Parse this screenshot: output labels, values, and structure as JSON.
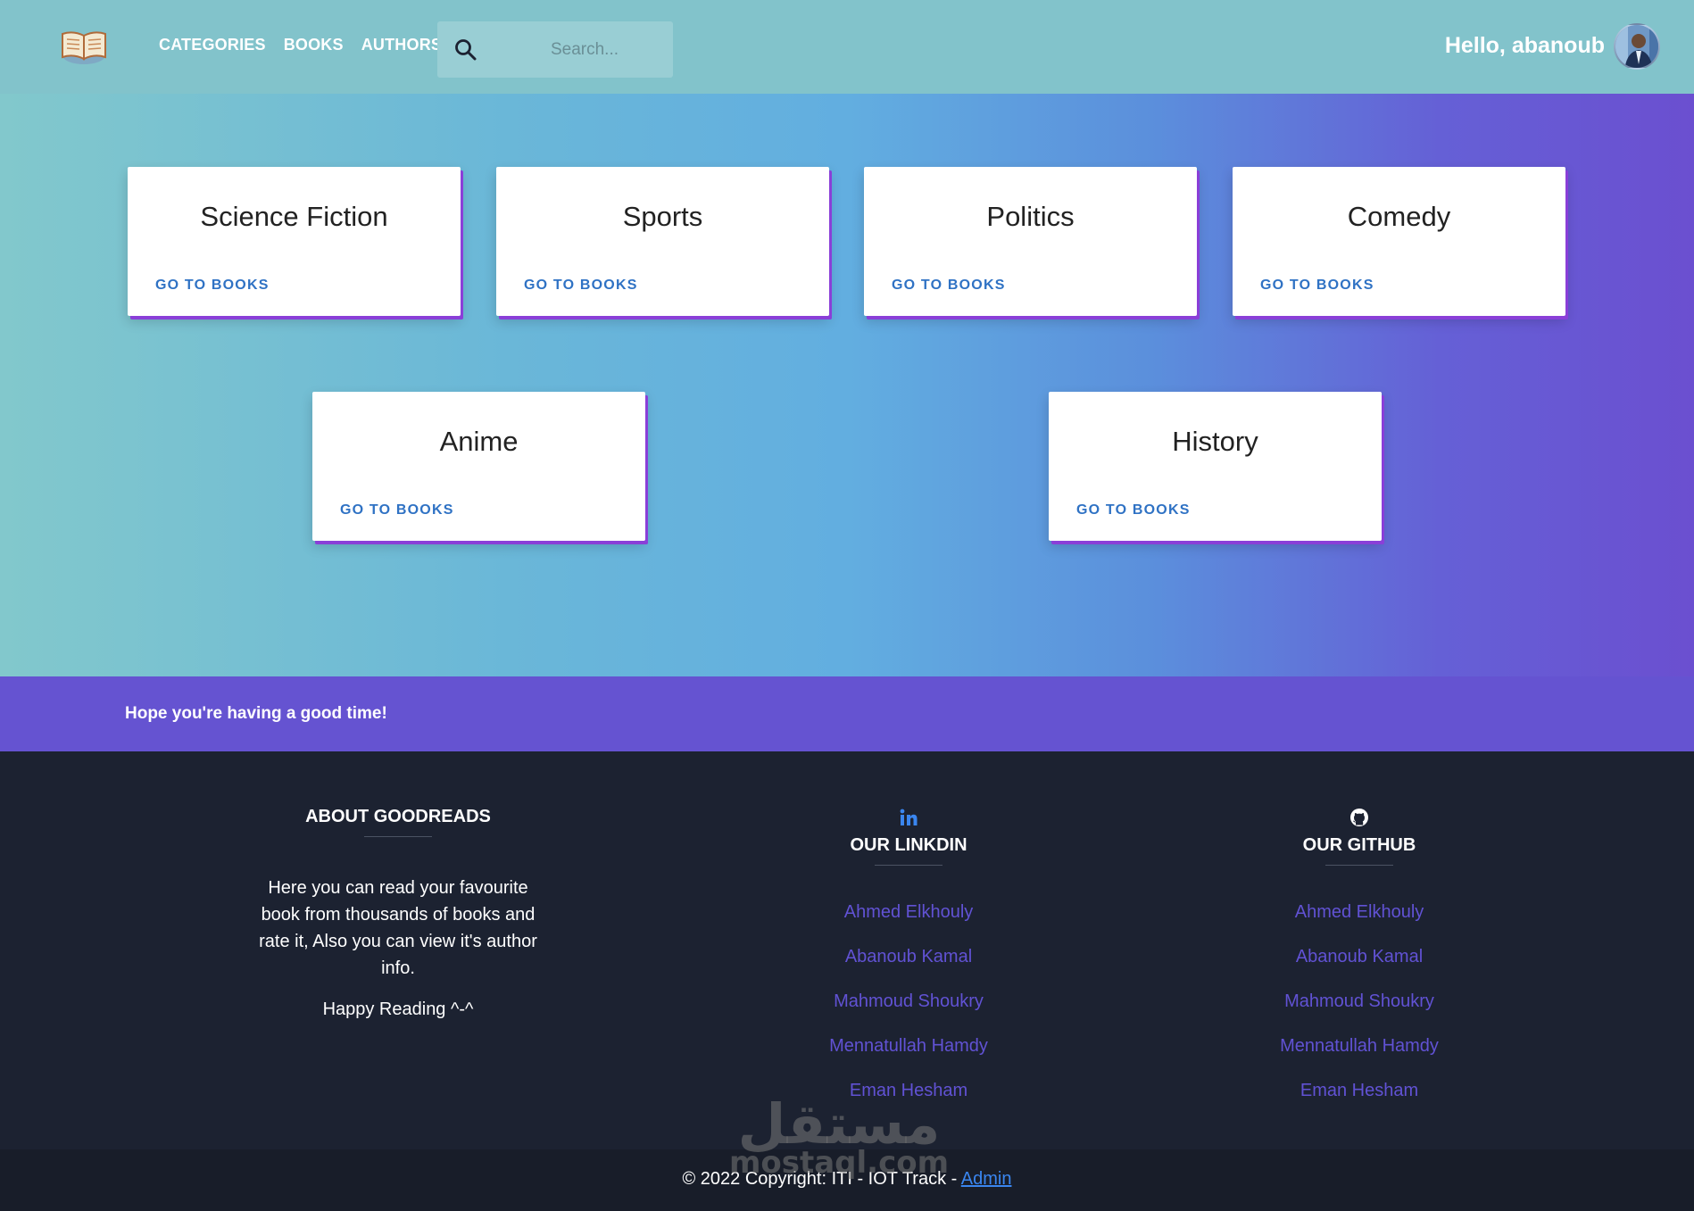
{
  "navbar": {
    "brand_icon": "open-book-icon",
    "links": [
      "CATEGORIES",
      "BOOKS",
      "AUTHORS"
    ],
    "search": {
      "placeholder": "Search...",
      "value": "",
      "icon": "search-icon"
    },
    "greeting": "Hello, abanoub",
    "avatar": "user-avatar"
  },
  "categories": [
    {
      "title": "Science Fiction",
      "link": "GO TO BOOKS"
    },
    {
      "title": "Sports",
      "link": "GO TO BOOKS"
    },
    {
      "title": "Politics",
      "link": "GO TO BOOKS"
    },
    {
      "title": "Comedy",
      "link": "GO TO BOOKS"
    },
    {
      "title": "Anime",
      "link": "GO TO BOOKS"
    },
    {
      "title": "History",
      "link": "GO TO BOOKS"
    }
  ],
  "banner": {
    "text": "Hope you're having a good time!"
  },
  "footer": {
    "about": {
      "heading": "ABOUT GOODREADS",
      "text": "Here you can read your favourite book from thousands of books and rate it, Also you can view it's author info.",
      "happy": "Happy Reading ^-^"
    },
    "linkedin": {
      "icon": "linkedin-icon",
      "heading": "OUR LINKDIN",
      "members": [
        "Ahmed Elkhouly",
        "Abanoub Kamal",
        "Mahmoud Shoukry",
        "Mennatullah Hamdy",
        "Eman Hesham"
      ]
    },
    "github": {
      "icon": "github-icon",
      "heading": "OUR GITHUB",
      "members": [
        "Ahmed Elkhouly",
        "Abanoub Kamal",
        "Mahmoud Shoukry",
        "Mennatullah Hamdy",
        "Eman Hesham"
      ]
    }
  },
  "watermark": {
    "arabic": "مستقل",
    "latin": "mostaql.com"
  },
  "copyright": {
    "text": "© 2022 Copyright: ITI - IOT Track - ",
    "admin_link": "Admin"
  },
  "colors": {
    "navbar": "#82c3cb",
    "banner": "#6553d1",
    "footer": "#1c2231",
    "card_accent": "#8a3fd8",
    "link": "#2f72c4",
    "footer_link": "#6152d4"
  }
}
